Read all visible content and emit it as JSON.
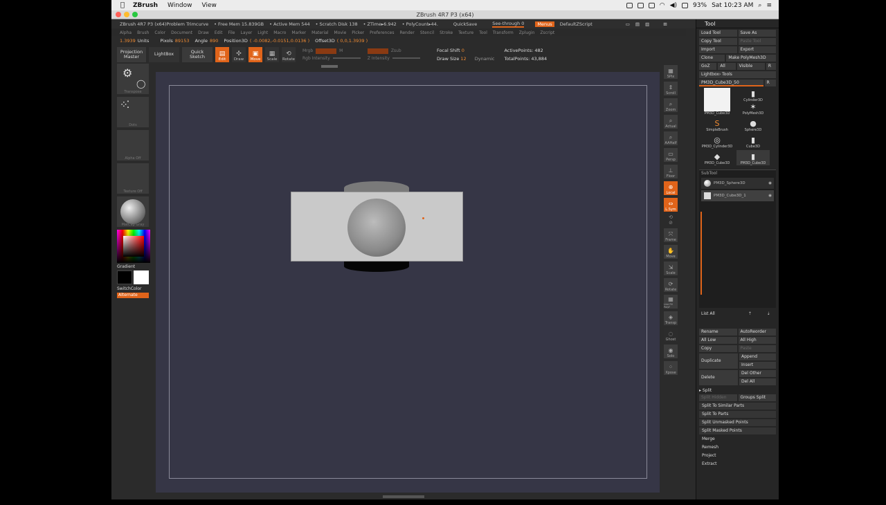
{
  "mac_menu": {
    "apple": "",
    "app": "ZBrush",
    "items": [
      "Window",
      "View"
    ],
    "battery": "93%",
    "clock": "Sat 10:23 AM"
  },
  "window": {
    "title": "ZBrush 4R7 P3 (x64)"
  },
  "info": {
    "doc": "ZBrush 4R7 P3 (x64)Problem Trimcurve",
    "free_mem": "• Free Mem 15.839GB",
    "active_mem": "• Active Mem 544",
    "scratch": "• Scratch Disk 138",
    "ztime": "• ZTime▸6.942",
    "polycount": "• PolyCount▸44.",
    "quicksave": "QuickSave",
    "see_through": "See-through  0",
    "menus": "Menus",
    "script": "DefaultZScript"
  },
  "main_menu": [
    "Alpha",
    "Brush",
    "Color",
    "Document",
    "Draw",
    "Edit",
    "File",
    "Layer",
    "Light",
    "Macro",
    "Marker",
    "Material",
    "Movie",
    "Picker",
    "Preferences",
    "Render",
    "Stencil",
    "Stroke",
    "Texture",
    "Tool",
    "Transform",
    "Zplugin",
    "Zscript"
  ],
  "units": {
    "units_value": "1.3939",
    "units_label": "Units",
    "pixols_label": "Pixols",
    "pixols_value": "89153",
    "angle_label": "Angle",
    "angle_value": "890",
    "pos_label": "Position3D",
    "pos_value": "( -0.0082,-0.0151,0.0136 )",
    "offset_label": "Offset3D",
    "offset_value": "( 0,0,1.3939 )"
  },
  "shelf": {
    "projection_master": "Projection Master",
    "lightbox": "LightBox",
    "quick_sketch": "Quick Sketch",
    "edit": "Edit",
    "draw": "Draw",
    "move": "Move",
    "scale": "Scale",
    "rotate": "Rotate",
    "mrgb": "Mrgb",
    "rgb": "Rgb",
    "m": "M",
    "zadd": "Zadd",
    "zsub": "Zsub",
    "rgb_intensity": "Rgb Intensity",
    "z_intensity": "Z Intensity",
    "focal_shift_label": "Focal Shift",
    "focal_shift_value": "0",
    "draw_size_label": "Draw Size",
    "draw_size_value": "12",
    "dynamic": "Dynamic",
    "active_points": "ActivePoints: 482",
    "total_points": "TotalPoints: 43,884"
  },
  "left_shelf": {
    "transpose": "Transpose",
    "dots": "Dots",
    "alpha_off": "Alpha Off",
    "texture_off": "Texture Off",
    "matcap": "MatCap Gray",
    "gradient": "Gradient",
    "switch_color": "SwitchColor",
    "alternate": "Alternate",
    "main_color": "#ffffff",
    "secondary_color": "#000000"
  },
  "right_shelf": [
    "SPix",
    "Scroll",
    "Zoom",
    "Actual",
    "AAHalf",
    "Persp",
    "Floor",
    "Local",
    "L.Sym",
    "Frame",
    "Move",
    "Scale",
    "Rotate",
    "Line Fill PolyF",
    "Transp",
    "Ghost",
    "Solo",
    "Xpose"
  ],
  "tool_palette": {
    "title": "Tool",
    "load_tool": "Load Tool",
    "save_as": "Save As",
    "copy_tool": "Copy Tool",
    "paste_tool": "Paste Tool",
    "import": "Import",
    "export": "Export",
    "clone": "Clone",
    "make_polymesh": "Make PolyMesh3D",
    "goz": "GoZ",
    "all": "All",
    "visible": "Visible",
    "r": "R",
    "lightbox_tools": "Lightbox› Tools",
    "current_tool": "PM3D_Cube3D_50",
    "thumbs": [
      "PM3D_Cube3D",
      "Cylinder3D",
      "PolyMesh3D",
      "SimpleBrush",
      "Sphere3D",
      "PM3D_Cylinder3D",
      "Cube3D",
      "PM3D_Cube3D",
      "PM3D_Cube3D"
    ],
    "subtool_header": "SubTool",
    "subtools": [
      "PM3D_Sphere3D",
      "PM3D_Cube3D_1"
    ],
    "list_all": "List All",
    "rename": "Rename",
    "auto_reorder": "AutoReorder",
    "all_low": "All Low",
    "all_high": "All High",
    "copy": "Copy",
    "paste": "Paste",
    "duplicate": "Duplicate",
    "append": "Append",
    "insert": "Insert",
    "delete": "Delete",
    "del_other": "Del Other",
    "del_all": "Del All",
    "split_header": "Split",
    "split_hidden": "Split Hidden",
    "groups_split": "Groups Split",
    "split_similar": "Split To Similar Parts",
    "split_parts": "Split To Parts",
    "split_unmasked": "Split Unmasked Points",
    "split_masked": "Split Masked Points",
    "merge": "Merge",
    "remesh": "Remesh",
    "project": "Project",
    "extract": "Extract"
  }
}
